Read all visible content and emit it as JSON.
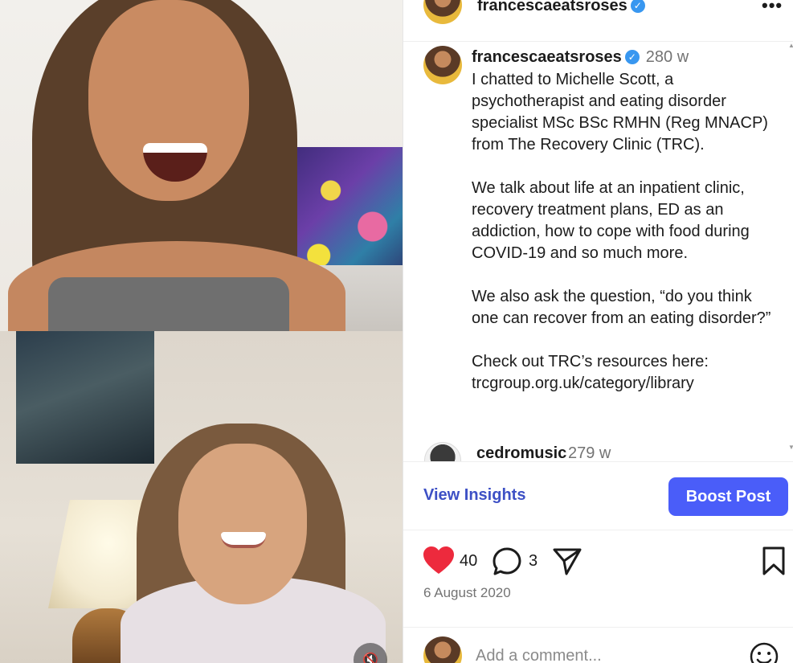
{
  "header": {
    "username": "francescaeatsroses",
    "verified_icon": "verified-badge-icon",
    "more_icon": "more-options-icon"
  },
  "caption": {
    "username": "francescaeatsroses",
    "time": "280 w",
    "paragraphs": [
      "I chatted to Michelle Scott, a psychotherapist and eating disorder specialist MSc BSc RMHN (Reg MNACP) from The Recovery Clinic (TRC).",
      "We talk about life at an inpatient clinic, recovery treatment plans, ED as an addiction, how to cope with food during COVID-19 and so much more.",
      "We also ask the question, “do you think one can recover from an eating disorder?”",
      "Check out TRC’s resources here:"
    ],
    "link": "trcgroup.org.uk/category/library"
  },
  "comments": [
    {
      "username": "cedromusic",
      "time": "279 w"
    }
  ],
  "insights": {
    "view_label": "View Insights",
    "boost_label": "Boost Post"
  },
  "actions": {
    "likes": "40",
    "comments": "3",
    "date": "6 August 2020"
  },
  "add_comment": {
    "placeholder": "Add a comment..."
  },
  "colors": {
    "accent_button": "#4a5df9",
    "insights_link": "#3d50c5",
    "like_heart": "#ed2a3d",
    "verified": "#3897f0",
    "secondary_text": "#737373"
  }
}
